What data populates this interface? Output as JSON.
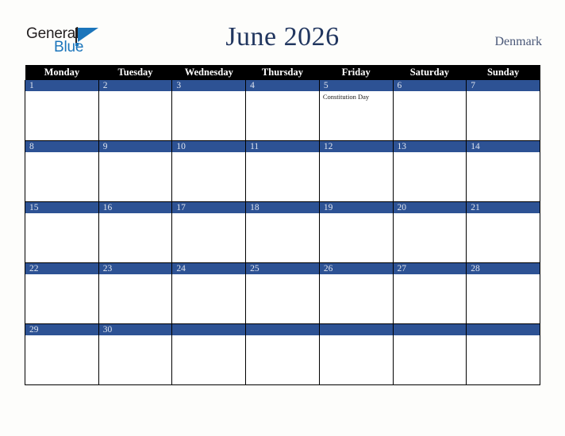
{
  "brand": {
    "word_one": "General",
    "word_two": "Blue",
    "mark": "triangle-logo-mark"
  },
  "header": {
    "title": "June 2026",
    "country": "Denmark"
  },
  "colors": {
    "page_background": "#fdfdfb",
    "header_row_background": "#000000",
    "date_band": "#2d5294",
    "title_text": "#21365f",
    "country_text": "#4a5878",
    "brand_blue": "#1b75bb",
    "cell_border": "#000000",
    "cell_background": "#ffffff"
  },
  "calendar": {
    "weekday_headers": [
      "Monday",
      "Tuesday",
      "Wednesday",
      "Thursday",
      "Friday",
      "Saturday",
      "Sunday"
    ],
    "weeks": [
      [
        {
          "day": "1",
          "events": []
        },
        {
          "day": "2",
          "events": []
        },
        {
          "day": "3",
          "events": []
        },
        {
          "day": "4",
          "events": []
        },
        {
          "day": "5",
          "events": [
            "Constitution Day"
          ]
        },
        {
          "day": "6",
          "events": []
        },
        {
          "day": "7",
          "events": []
        }
      ],
      [
        {
          "day": "8",
          "events": []
        },
        {
          "day": "9",
          "events": []
        },
        {
          "day": "10",
          "events": []
        },
        {
          "day": "11",
          "events": []
        },
        {
          "day": "12",
          "events": []
        },
        {
          "day": "13",
          "events": []
        },
        {
          "day": "14",
          "events": []
        }
      ],
      [
        {
          "day": "15",
          "events": []
        },
        {
          "day": "16",
          "events": []
        },
        {
          "day": "17",
          "events": []
        },
        {
          "day": "18",
          "events": []
        },
        {
          "day": "19",
          "events": []
        },
        {
          "day": "20",
          "events": []
        },
        {
          "day": "21",
          "events": []
        }
      ],
      [
        {
          "day": "22",
          "events": []
        },
        {
          "day": "23",
          "events": []
        },
        {
          "day": "24",
          "events": []
        },
        {
          "day": "25",
          "events": []
        },
        {
          "day": "26",
          "events": []
        },
        {
          "day": "27",
          "events": []
        },
        {
          "day": "28",
          "events": []
        }
      ],
      [
        {
          "day": "29",
          "events": []
        },
        {
          "day": "30",
          "events": []
        },
        {
          "day": "",
          "events": []
        },
        {
          "day": "",
          "events": []
        },
        {
          "day": "",
          "events": []
        },
        {
          "day": "",
          "events": []
        },
        {
          "day": "",
          "events": []
        }
      ]
    ]
  }
}
